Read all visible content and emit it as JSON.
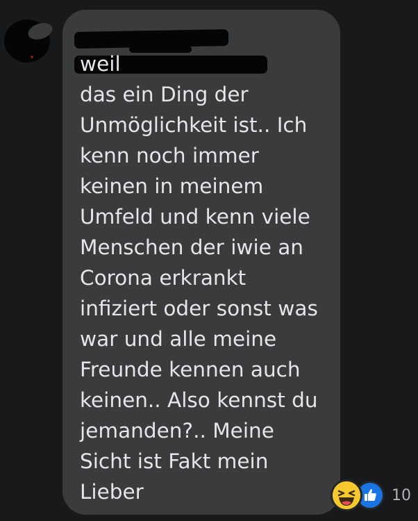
{
  "comment": {
    "text": "weil\ndas ein Ding der\nUnmöglichkeit ist.. Ich\nkenn noch immer\nkeinen in meinem\nUmfeld und kenn viele\nMenschen der iwie an\nCorona erkrankt\ninfiziert oder sonst was\nwar und alle meine\nFreunde kennen auch\nkeinen.. Also kennst du\njemanden?.. Meine\nSicht ist Fakt mein\nLieber"
  },
  "reactions": {
    "icons": [
      "haha-icon",
      "like-icon"
    ],
    "count": "10"
  },
  "colors": {
    "background": "#18191a",
    "bubble": "#3a3b3c",
    "text": "#e4e6eb",
    "like": "#1b74e4",
    "haha": "#f7c92f"
  }
}
